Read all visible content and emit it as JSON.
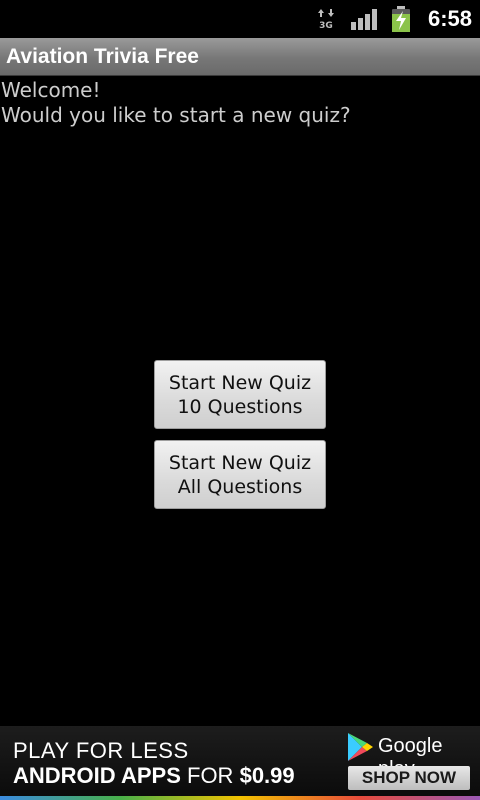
{
  "status_bar": {
    "network_label": "3G",
    "time": "6:58",
    "icons": [
      "data-arrows-icon",
      "signal-icon",
      "battery-charging-icon"
    ],
    "battery_color": "#8bc34a"
  },
  "title_bar": {
    "title": "Aviation Trivia Free"
  },
  "content": {
    "welcome_line1": "Welcome!",
    "welcome_line2": "Would you like to start a new quiz?"
  },
  "buttons": [
    {
      "line1": "Start New Quiz",
      "line2": "10 Questions"
    },
    {
      "line1": "Start New Quiz",
      "line2": "All Questions"
    }
  ],
  "ad_banner": {
    "headline": "PLAY FOR LESS",
    "line2_bold": "ANDROID APPS",
    "line2_mid": "FOR",
    "line2_price": "$0.99",
    "brand": "Google play",
    "cta": "SHOP NOW"
  }
}
